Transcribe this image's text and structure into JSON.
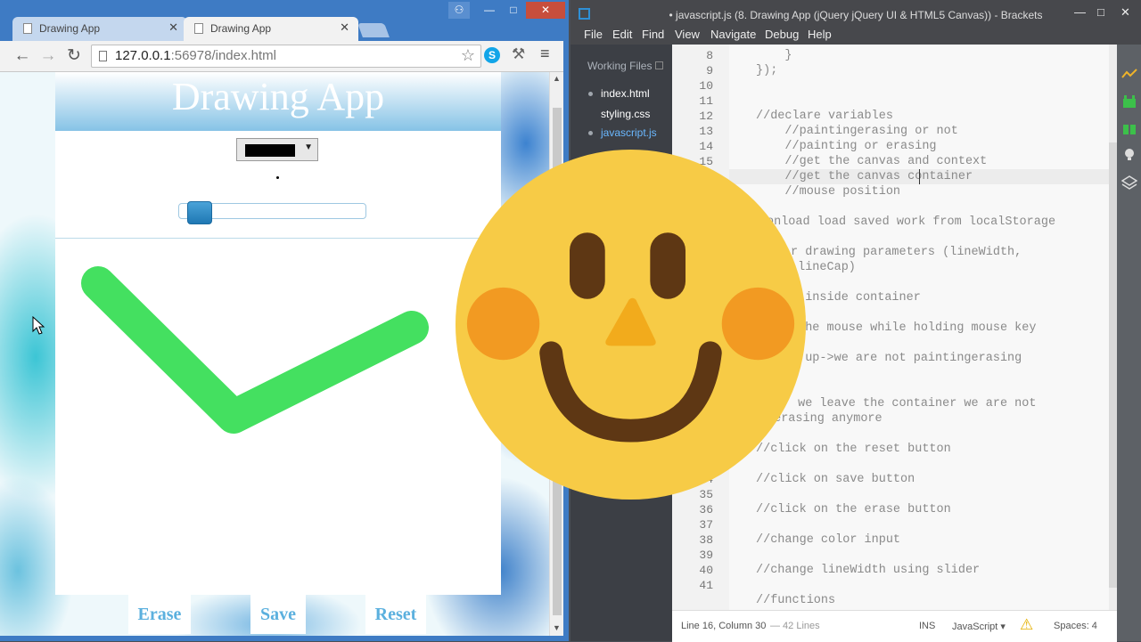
{
  "browser": {
    "tabs": [
      {
        "label": "Drawing App",
        "active": false
      },
      {
        "label": "Drawing App",
        "active": true
      }
    ],
    "url_host": "127.0.0.1",
    "url_rest": ":56978/index.html",
    "window_controls": {
      "minimize": "—",
      "maximize": "□",
      "close": "✕"
    }
  },
  "app": {
    "title": "Drawing App",
    "buttons": {
      "erase": "Erase",
      "save": "Save",
      "reset": "Reset"
    },
    "selected_color": "#000000",
    "stroke_color": "#44e060",
    "slider_value_fraction": 0.05
  },
  "brackets": {
    "title": "• javascript.js (8. Drawing App (jQuery jQuery UI & HTML5 Canvas)) - Brackets",
    "menu": [
      "File",
      "Edit",
      "Find",
      "View",
      "Navigate",
      "Debug",
      "Help"
    ],
    "working_files_label": "Working Files",
    "working_files": [
      "index.html",
      "styling.css",
      "javascript.js"
    ],
    "line_numbers": [
      "8",
      "9",
      "10",
      "11",
      "12",
      "13",
      "14",
      "15",
      "16",
      "17",
      "34",
      "35",
      "36",
      "37",
      "38",
      "39",
      "40",
      "41"
    ],
    "code_lines": [
      "    }",
      "});",
      "",
      "",
      "//declare variables",
      "    //paintingerasing or not",
      "    //painting or erasing",
      "    //get the canvas and context",
      "    //get the canvas container",
      "    //mouse position",
      "onload load saved work from localStorage",
      "r drawing parameters (lineWidth,",
      " lineCap)",
      "k inside container",
      " the mouse while holding mouse key",
      "e up->we are not paintingerasing",
      " we leave the container we are not",
      "gerasing anymore",
      "//click on the reset button",
      "//click on save button",
      "//click on the erase button",
      "//change color input",
      "//change lineWidth using slider",
      "//functions"
    ],
    "status": {
      "cursor": "Line 16, Column 30",
      "lines": "— 42 Lines",
      "mode": "INS",
      "language": "JavaScript ▾",
      "spaces": "Spaces: 4"
    }
  },
  "icons": [
    "tab-page-icon",
    "back-arrow-icon",
    "forward-arrow-icon",
    "reload-icon",
    "star-icon",
    "skype-icon",
    "tools-icon",
    "menu-icon",
    "mouse-cursor-icon",
    "smiley-face-icon",
    "warning-icon"
  ]
}
